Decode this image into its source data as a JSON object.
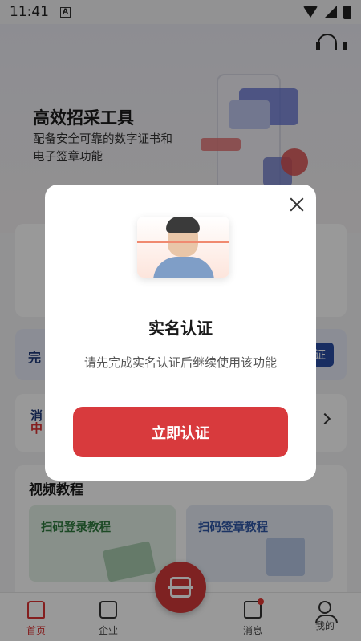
{
  "status_bar": {
    "time": "11:41",
    "notification_icon_letter": "A"
  },
  "hero": {
    "title": "高效招采工具",
    "subtitle": "配备安全可靠的数字证书和电子签章功能"
  },
  "complete_banner": {
    "text": "完",
    "button": "证"
  },
  "news": {
    "line1": "消",
    "line2": "中"
  },
  "videos": {
    "title": "视频教程",
    "items": [
      {
        "label": "扫码登录教程"
      },
      {
        "label": "扫码签章教程"
      }
    ]
  },
  "bottom_nav": {
    "items": [
      {
        "label": "首页",
        "active": true
      },
      {
        "label": "企业",
        "active": false
      },
      {
        "label": "消息",
        "active": false,
        "has_badge": true
      },
      {
        "label": "我的",
        "active": false
      }
    ]
  },
  "modal": {
    "title": "实名认证",
    "description": "请先完成实名认证后继续使用该功能",
    "button": "立即认证"
  },
  "colors": {
    "accent_red": "#d83a3d",
    "primary_blue": "#2a4da3"
  }
}
